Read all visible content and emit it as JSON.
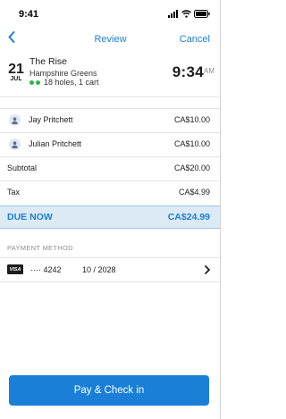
{
  "status_bar": {
    "time": "9:41",
    "icons": [
      "signal-icon",
      "wifi-icon",
      "battery-icon"
    ]
  },
  "nav": {
    "title": "Review",
    "cancel_label": "Cancel",
    "back_icon": "chevron-left-icon"
  },
  "booking": {
    "day": "21",
    "month": "JUL",
    "course_name": "The Rise",
    "course_subtitle": "Hampshire Greens",
    "details": "18 holes, 1 cart",
    "time": "9:34",
    "ampm": "AM"
  },
  "players": [
    {
      "name": "Jay Pritchett",
      "amount": "CA$10.00"
    },
    {
      "name": "Julian Pritchett",
      "amount": "CA$10.00"
    }
  ],
  "summary": {
    "subtotal_label": "Subtotal",
    "subtotal_amount": "CA$20.00",
    "tax_label": "Tax",
    "tax_amount": "CA$4.99",
    "due_label": "DUE NOW",
    "due_amount": "CA$24.99"
  },
  "payment": {
    "header": "PAYMENT METHOD",
    "card_brand": "VISA",
    "card_number": "···· 4242",
    "card_expiry": "10 / 2028"
  },
  "pay_button_label": "Pay & Check in",
  "colors": {
    "accent": "#1a7fd6",
    "due_background": "#dceaf6",
    "status_dot": "#2bb44a"
  }
}
